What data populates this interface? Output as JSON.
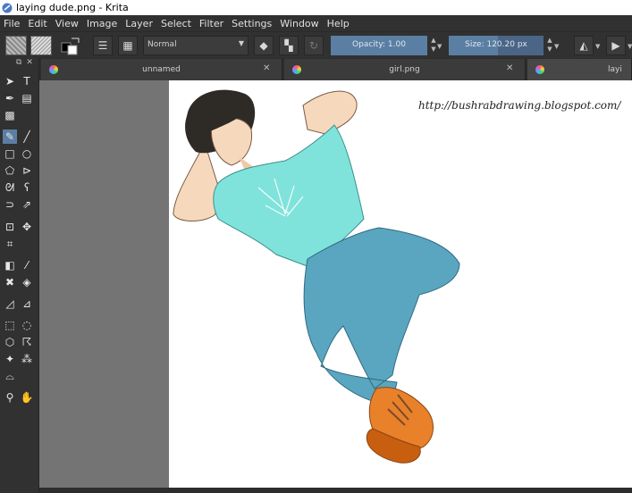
{
  "window": {
    "title": "laying dude.png  - Krita"
  },
  "menu": [
    "File",
    "Edit",
    "View",
    "Image",
    "Layer",
    "Select",
    "Filter",
    "Settings",
    "Window",
    "Help"
  ],
  "toolbar": {
    "blend_mode": "Normal",
    "opacity_label": "Opacity:  1.00",
    "size_label": "Size:  120.20 px"
  },
  "tabs": [
    {
      "label": "unnamed"
    },
    {
      "label": "girl.png"
    },
    {
      "label": "layi"
    }
  ],
  "canvas": {
    "watermark": "http://bushrabdrawing.blogspot.com/"
  },
  "colors": {
    "accent": "#5b7fa3",
    "shirt": "#7fe3dc",
    "jeans": "#5aa6c0",
    "shoes": "#e8812a"
  }
}
